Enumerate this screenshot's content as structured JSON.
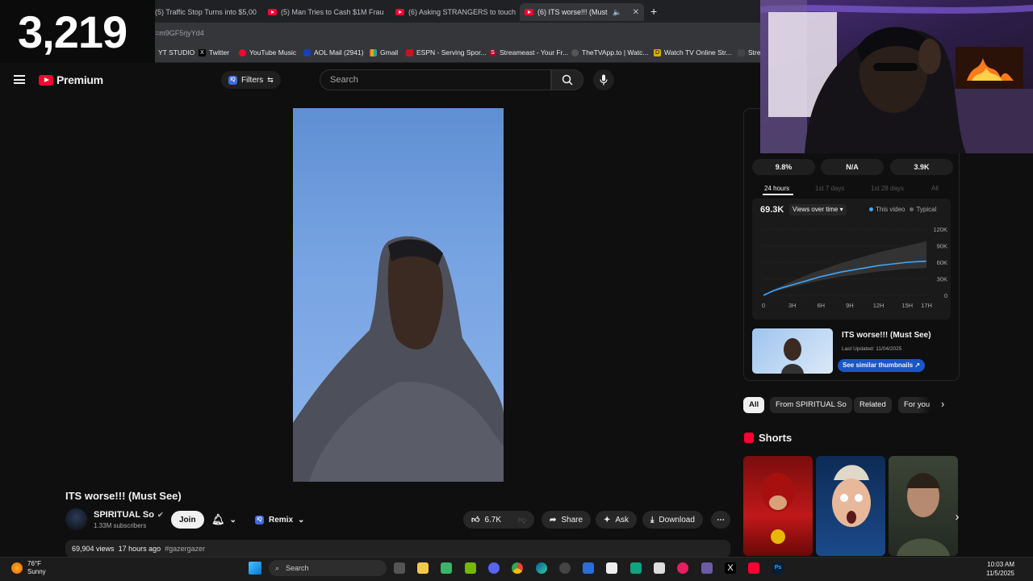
{
  "counter": {
    "value": "3,219"
  },
  "browser": {
    "tabs": [
      {
        "label": "(5) Traffic Stop Turns into $5,00"
      },
      {
        "label": "(5) Man Tries to Cash $1M Frau"
      },
      {
        "label": "(6) Asking STRANGERS to touch"
      },
      {
        "label": "(6) ITS worse!!! (Must See)"
      }
    ],
    "new_tab_label": "+",
    "url": "=m9GF5rjyYd4",
    "bookmarks": [
      "YT STUDIO",
      "Twitter",
      "YouTube Music",
      "AOL Mail (2941)",
      "Gmail",
      "ESPN - Serving Spor...",
      "Streameast - Your Fr...",
      "TheTVApp.to | Watc...",
      "Watch TV Online Str...",
      "Stre"
    ]
  },
  "header": {
    "logo": "Premium",
    "filters": "Filters",
    "search_placeholder": "Search"
  },
  "video": {
    "title": "ITS worse!!! (Must See)",
    "channel": "SPIRITUAL So",
    "subscribers": "1.33M subscribers",
    "join": "Join",
    "remix": "Remix",
    "likes": "6.7K",
    "share": "Share",
    "ask": "Ask",
    "download": "Download",
    "views": "69,904 views",
    "age": "17 hours ago",
    "hashtag": "#gazergazer"
  },
  "analytics": {
    "stats": [
      "9.8%",
      "N/A",
      "3.9K"
    ],
    "tabs": [
      "24 hours",
      "1st 7 days",
      "1st 28 days",
      "All"
    ],
    "views_total": "69.3K",
    "metric": "Views over time",
    "legend": [
      "This video",
      "Typical"
    ],
    "y_ticks": [
      "120K",
      "90K",
      "60K",
      "30K",
      "0"
    ],
    "x_ticks": [
      "0",
      "3H",
      "6H",
      "9H",
      "12H",
      "15H",
      "17H"
    ],
    "compare_title": "ITS worse!!! (Must See)",
    "last_updated": "Last Updated: 11/04/2025",
    "similar_btn": "See similar thumbnails"
  },
  "chart_data": {
    "type": "line",
    "x": [
      0,
      1,
      2,
      3,
      4,
      5,
      6,
      7,
      8,
      9,
      10,
      11,
      12,
      13,
      14,
      15,
      16,
      17
    ],
    "series": [
      {
        "name": "This video",
        "values": [
          0,
          8,
          14,
          19,
          24,
          29,
          34,
          38,
          42,
          45,
          48,
          51,
          54,
          56,
          58,
          60,
          61,
          62
        ]
      },
      {
        "name": "Typical",
        "values": [
          0,
          10,
          18,
          26,
          33,
          40,
          46,
          52,
          58,
          63,
          68,
          73,
          78,
          82,
          86,
          90,
          94,
          98
        ]
      }
    ],
    "ylim": [
      0,
      120000
    ],
    "ylabel": "",
    "xlabel": "",
    "title": "",
    "colors": {
      "This video": "#3ea6ff",
      "Typical": "#555555"
    }
  },
  "chips": [
    "All",
    "From SPIRITUAL So",
    "Related",
    "For you"
  ],
  "shorts_title": "Shorts",
  "taskbar": {
    "temp": "76°F",
    "condition": "Sunny",
    "search": "Search",
    "time": "10:03 AM",
    "date": "11/5/2025"
  }
}
